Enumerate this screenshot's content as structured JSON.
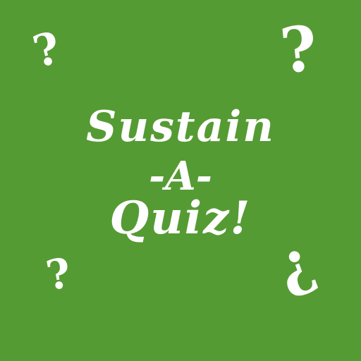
{
  "colors": {
    "background": "#559B33",
    "text": "#FFFFFF"
  },
  "title": {
    "line1": "Sustain",
    "line2": "-A-",
    "line3": "Quiz!"
  },
  "decorations": {
    "mark": "?",
    "icon": "question-mark-icon"
  }
}
